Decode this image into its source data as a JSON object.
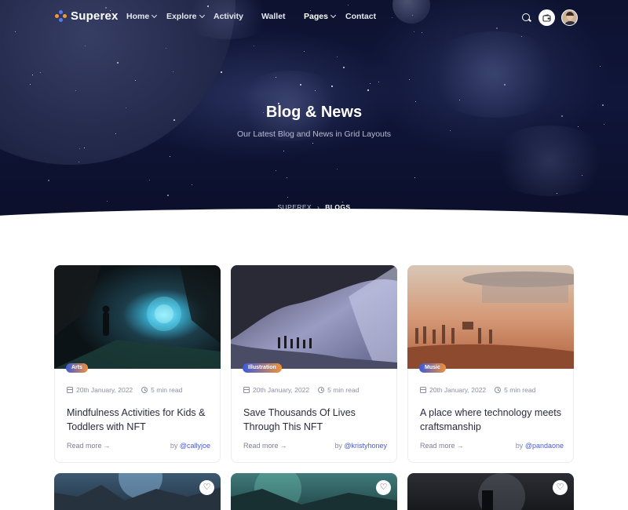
{
  "brand": {
    "name": "Superex"
  },
  "nav": {
    "items": [
      {
        "label": "Home",
        "dropdown": true
      },
      {
        "label": "Explore",
        "dropdown": true
      },
      {
        "label": "Activity",
        "dropdown": false
      },
      {
        "label": "Wallet",
        "dropdown": false
      },
      {
        "label": "Pages",
        "dropdown": true,
        "active": true
      },
      {
        "label": "Contact",
        "dropdown": false
      }
    ],
    "icons": [
      "search-icon",
      "wallet-icon",
      "avatar"
    ]
  },
  "hero": {
    "title": "Blog & News",
    "subtitle": "Our Latest Blog and News in Grid Layouts",
    "breadcrumb": {
      "home": "SUPEREX",
      "separator": "›",
      "current": "BLOGS"
    }
  },
  "posts": [
    {
      "category": "Arts",
      "date": "20th January, 2022",
      "read_time": "5 min read",
      "title": "Mindfulness Activities for Kids & Toddlers with NFT",
      "read_more": "Read more",
      "author_prefix": "by",
      "author": "@callyjoe"
    },
    {
      "category": "Illustration",
      "date": "20th January, 2022",
      "read_time": "5 min read",
      "title": "Save Thousands Of Lives Through This NFT",
      "read_more": "Read more",
      "author_prefix": "by",
      "author": "@kristyhoney"
    },
    {
      "category": "Music",
      "date": "20th January, 2022",
      "read_time": "5 min read",
      "title": "A place where technology meets craftsmanship",
      "read_more": "Read more",
      "author_prefix": "by",
      "author": "@pandaone"
    }
  ],
  "colors": {
    "badge_gradient_start": "#3a5bd9",
    "badge_gradient_end": "#f2913a",
    "accent": "#4a5bd4",
    "hero_bg": "#0d1230"
  }
}
